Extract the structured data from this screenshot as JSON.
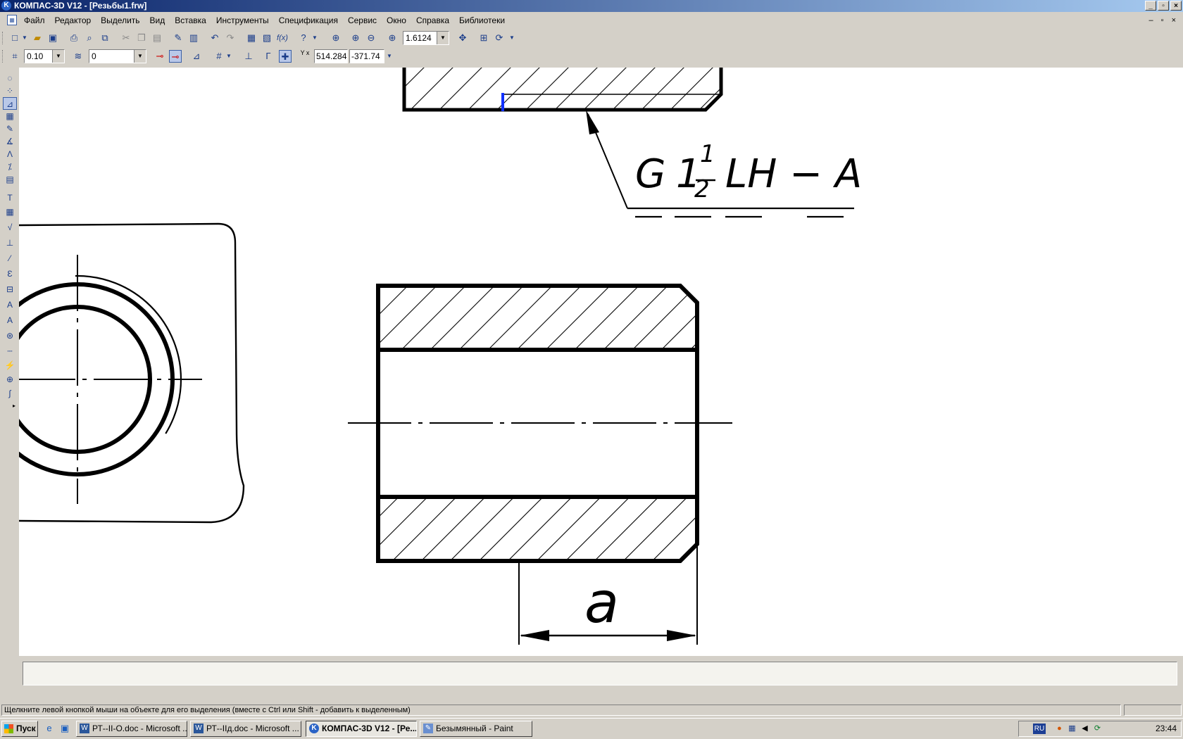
{
  "window": {
    "title": "КОМПАС-3D V12 - [Резьбы1.frw]",
    "app_icon": "kompas-icon",
    "controls": [
      "_",
      "▫",
      "×"
    ]
  },
  "menu": {
    "items": [
      "Файл",
      "Редактор",
      "Выделить",
      "Вид",
      "Вставка",
      "Инструменты",
      "Спецификация",
      "Сервис",
      "Окно",
      "Справка",
      "Библиотеки"
    ],
    "mdi_controls": "–  ▫  ×"
  },
  "toolbar1": {
    "zoom_value": "1.6124"
  },
  "toolbar2": {
    "step_value": "0.10",
    "layer_value": "0",
    "coord_label": "Y x",
    "coord_x": "514.284",
    "coord_y": "-371.74"
  },
  "drawing": {
    "thread_designation": {
      "g": "G",
      "whole": "1",
      "num": "1",
      "den": "2",
      "suffix": "LH − A"
    },
    "dimension_label": "a"
  },
  "statusbar": {
    "hint": "Щелкните левой кнопкой мыши на объекте для его выделения (вместе с Ctrl или Shift - добавить к выделенным)"
  },
  "taskbar": {
    "start_label": "Пуск",
    "tasks": [
      {
        "label": "РТ--II-О.doc - Microsoft ...",
        "icon": "word-icon",
        "active": false
      },
      {
        "label": "РТ--IIд.doc - Microsoft ...",
        "icon": "word-icon",
        "active": false
      },
      {
        "label": "КОМПАС-3D V12 - [Ре...",
        "icon": "kompas-icon",
        "active": true
      },
      {
        "label": "Безымянный - Paint",
        "icon": "paint-icon",
        "active": false
      }
    ],
    "language": "RU",
    "clock": "23:44"
  }
}
